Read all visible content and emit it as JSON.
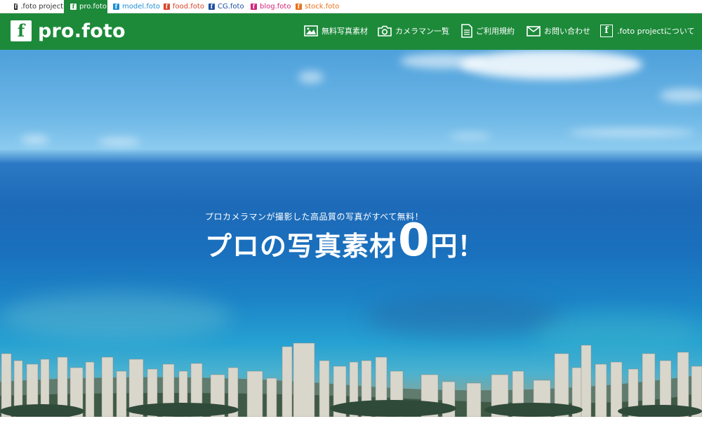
{
  "colors": {
    "brand_green": "#1d8a3a",
    "tab_text": "#333333"
  },
  "site_tabs": [
    {
      "label": ".foto project",
      "color": "#222222",
      "active": false
    },
    {
      "label": "pro.foto",
      "color": "#1d8a3a",
      "active": true
    },
    {
      "label": "model.foto",
      "color": "#1e8fd3",
      "active": false
    },
    {
      "label": "food.foto",
      "color": "#d8442b",
      "active": false
    },
    {
      "label": "CG.foto",
      "color": "#1b4fa0",
      "active": false
    },
    {
      "label": "blog.foto",
      "color": "#d4237a",
      "active": false
    },
    {
      "label": "stock.foto",
      "color": "#e8711a",
      "active": false
    }
  ],
  "header": {
    "logo_mark": "f",
    "logo_text": "pro.foto",
    "nav": [
      {
        "label": "無料写真素材",
        "icon": "photo-icon"
      },
      {
        "label": "カメラマン一覧",
        "icon": "camera-icon"
      },
      {
        "label": "ご利用規約",
        "icon": "document-icon"
      },
      {
        "label": "お問い合わせ",
        "icon": "mail-icon"
      },
      {
        "label": ".foto projectについて",
        "icon": "foto-logo-icon"
      }
    ]
  },
  "hero": {
    "subtitle": "プロカメラマンが撮影した高品質の写真がすべて無料！",
    "title_part1": "プロの写真素材",
    "title_zero": "0",
    "title_part2": "円！"
  }
}
